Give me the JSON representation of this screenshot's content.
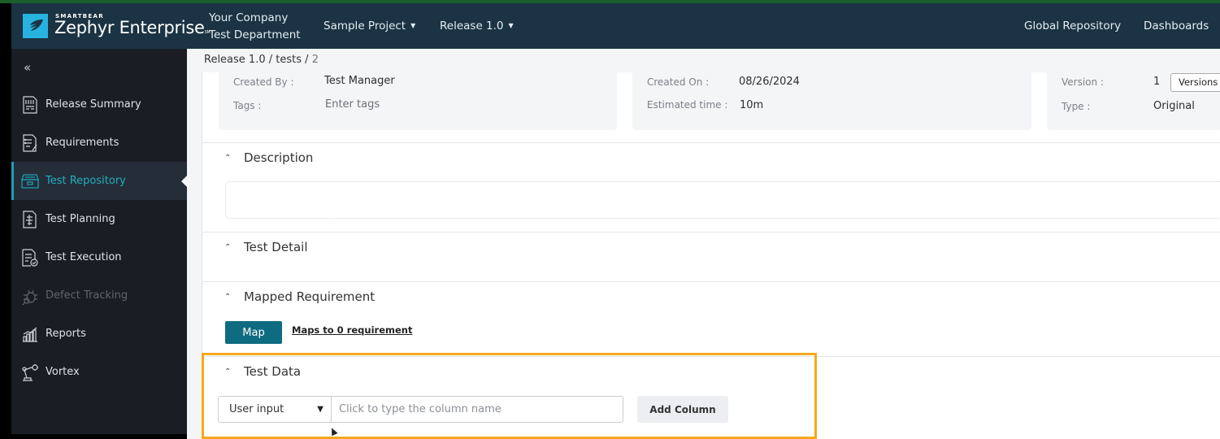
{
  "header": {
    "brand_small": "SMARTBEAR",
    "brand_main": "Zephyr Enterprise",
    "brand_mark": "SM",
    "company": "Your Company",
    "department": "Test Department",
    "project": "Sample Project",
    "release": "Release 1.0",
    "links": [
      "Global Repository",
      "Dashboards"
    ]
  },
  "sidebar": {
    "collapse_icon": "double-chevron-left",
    "items": [
      {
        "label": "Release Summary",
        "icon": "report-document",
        "state": "normal"
      },
      {
        "label": "Requirements",
        "icon": "requirements-checklist",
        "state": "normal"
      },
      {
        "label": "Test Repository",
        "icon": "archive-box",
        "state": "active"
      },
      {
        "label": "Test Planning",
        "icon": "planning-document",
        "state": "normal"
      },
      {
        "label": "Test Execution",
        "icon": "execution-checklist",
        "state": "normal"
      },
      {
        "label": "Defect Tracking",
        "icon": "bug",
        "state": "disabled"
      },
      {
        "label": "Reports",
        "icon": "bar-chart",
        "state": "normal"
      },
      {
        "label": "Vortex",
        "icon": "robot-arm",
        "state": "normal"
      }
    ]
  },
  "breadcrumb": {
    "items": [
      "Release 1.0",
      "tests"
    ],
    "current": "2",
    "separator": "/"
  },
  "details": {
    "created_by_label": "Created By :",
    "created_by": "Test Manager",
    "tags_label": "Tags :",
    "tags_placeholder": "Enter tags",
    "created_on_label": "Created On :",
    "created_on": "08/26/2024",
    "estimated_time_label": "Estimated time :",
    "estimated_time": "10m",
    "version_label": "Version :",
    "version": "1",
    "versions_button": "Versions",
    "type_label": "Type :",
    "type": "Original"
  },
  "sections": {
    "description": {
      "title": "Description",
      "value": ""
    },
    "test_detail": {
      "title": "Test Detail"
    },
    "mapped_requirement": {
      "title": "Mapped Requirement",
      "map_button": "Map",
      "maps_link": "Maps to 0 requirement"
    },
    "test_data": {
      "title": "Test Data",
      "type_select": "User input",
      "column_input_value": "",
      "column_input_placeholder": "Click to type the column name",
      "add_column_button": "Add Column"
    }
  },
  "colors": {
    "header_bg": "#1b3343",
    "sidebar_bg": "#1a1d24",
    "accent": "#1aa1b3",
    "primary_button": "#0f6b80",
    "highlight": "#f6a81c"
  }
}
